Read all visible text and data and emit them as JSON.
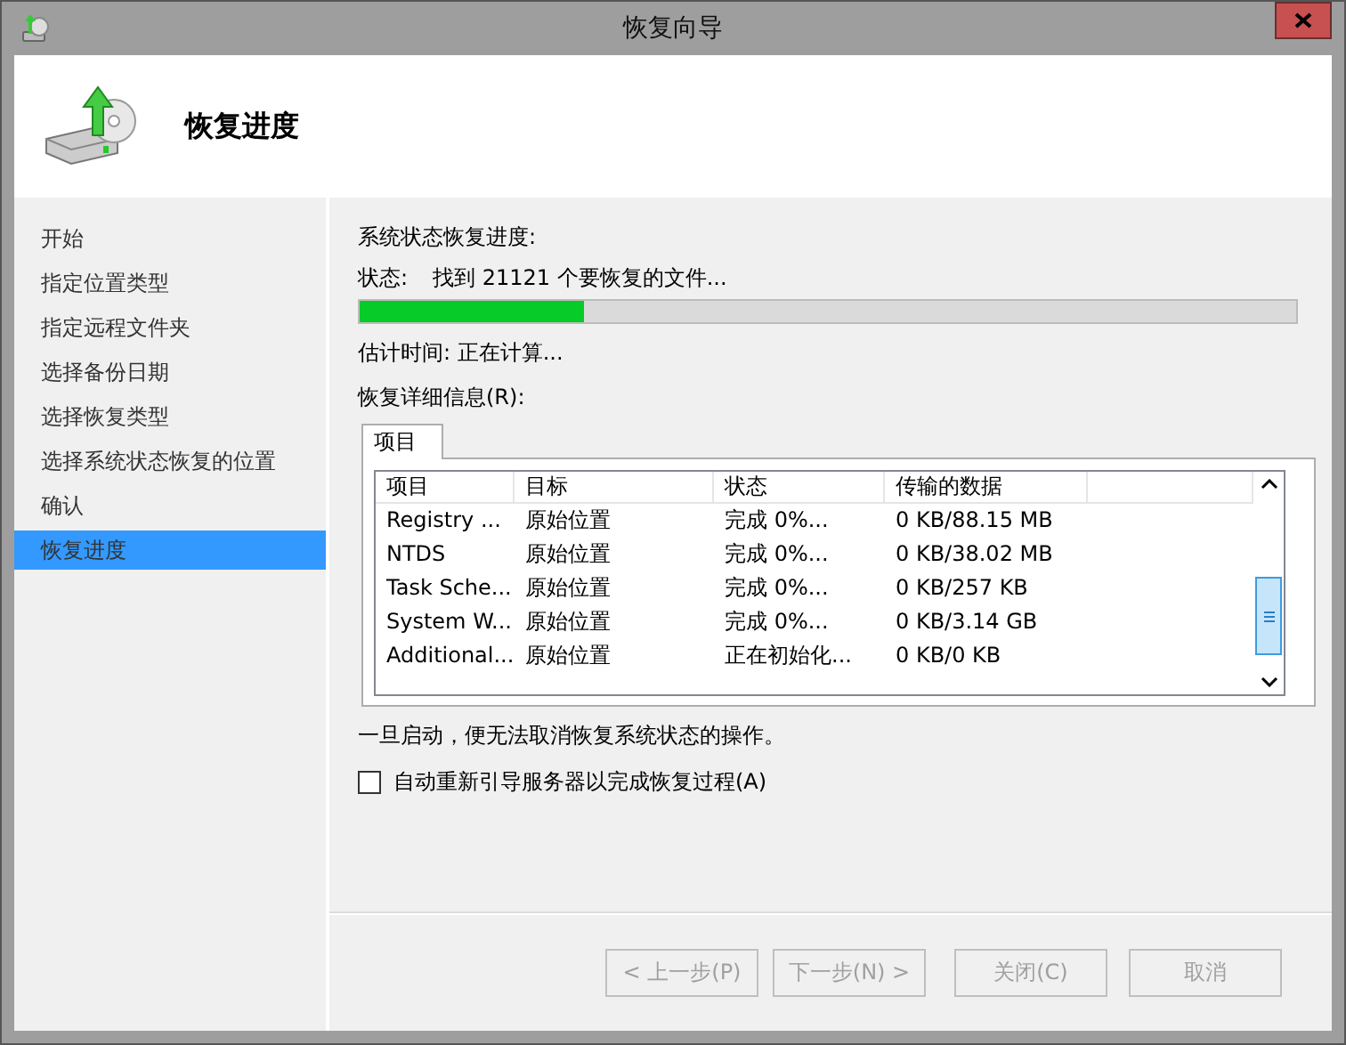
{
  "window": {
    "title": "恢复向导"
  },
  "header": {
    "title": "恢复进度"
  },
  "sidebar": {
    "items": [
      {
        "label": "开始",
        "selected": false
      },
      {
        "label": "指定位置类型",
        "selected": false
      },
      {
        "label": "指定远程文件夹",
        "selected": false
      },
      {
        "label": "选择备份日期",
        "selected": false
      },
      {
        "label": "选择恢复类型",
        "selected": false
      },
      {
        "label": "选择系统状态恢复的位置",
        "selected": false
      },
      {
        "label": "确认",
        "selected": false
      },
      {
        "label": "恢复进度",
        "selected": true
      }
    ]
  },
  "progress": {
    "heading": "系统状态恢复进度:",
    "status_label": "状态:",
    "status_text": "找到 21121 个要恢复的文件...",
    "level": 0.24,
    "estimate": "估计时间: 正在计算..."
  },
  "details": {
    "label": "恢复详细信息(R):",
    "tabs": [
      {
        "label": "项目",
        "selected": true
      }
    ],
    "columns": [
      "项目",
      "目标",
      "状态",
      "传输的数据"
    ],
    "rows": [
      [
        "Registry ...",
        "原始位置",
        "完成 0%...",
        "0 KB/88.15 MB"
      ],
      [
        "NTDS",
        "原始位置",
        "完成 0%...",
        "0 KB/38.02 MB"
      ],
      [
        "Task Sche...",
        "原始位置",
        "完成 0%...",
        "0 KB/257 KB"
      ],
      [
        "System W...",
        "原始位置",
        "完成 0%...",
        "0 KB/3.14 GB"
      ],
      [
        "Additional...",
        "原始位置",
        "正在初始化...",
        "0 KB/0 KB"
      ]
    ]
  },
  "warning": "一旦启动，便无法取消恢复系统状态的操作。",
  "reboot_option": {
    "label": "自动重新引导服务器以完成恢复过程(A)",
    "checked": false
  },
  "buttons": [
    {
      "label": "< 上一步(P)",
      "disabled": true
    },
    {
      "label": "下一步(N) >",
      "disabled": true
    },
    {
      "label": "关闭(C)",
      "disabled": true
    },
    {
      "label": "取消",
      "disabled": true
    }
  ]
}
